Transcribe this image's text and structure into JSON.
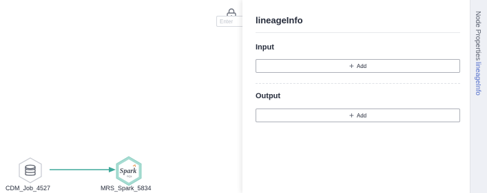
{
  "canvas": {
    "search_placeholder": "Enter",
    "nodes": [
      {
        "label": "CDM_Job_4527",
        "icon": "cdm-job-icon"
      },
      {
        "label": "MRS_Spark_5834",
        "icon": "spark-sql-icon",
        "icon_text": "Spark",
        "icon_subtext": "SQL"
      }
    ],
    "edge_color": "#3fa89a"
  },
  "panel": {
    "title": "lineageInfo",
    "input": {
      "title": "Input",
      "add_label": "Add"
    },
    "output": {
      "title": "Output",
      "add_label": "Add"
    }
  },
  "tabs": [
    {
      "label": "Node Properties",
      "active": false
    },
    {
      "label": "lineageInfo",
      "active": true
    }
  ],
  "colors": {
    "accent": "#526ecc",
    "spark_ring": "#a6dcd2"
  }
}
